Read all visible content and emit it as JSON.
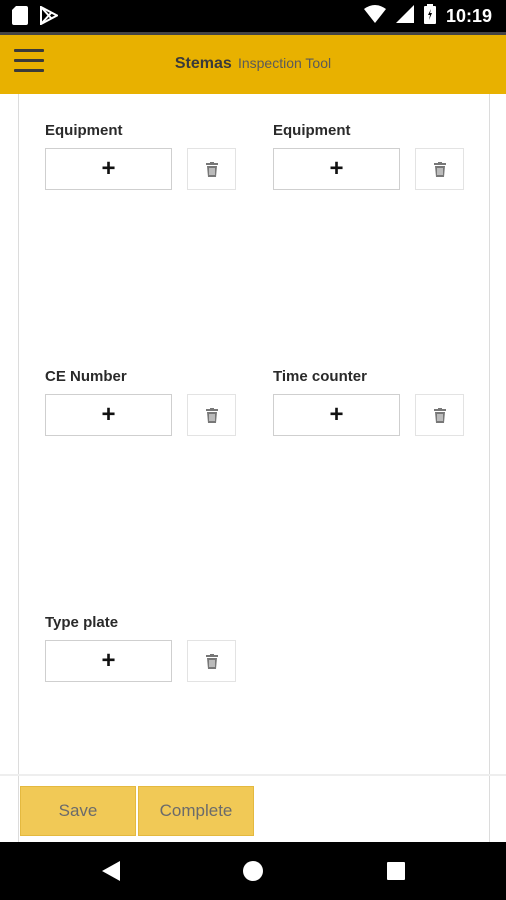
{
  "status_bar": {
    "time": "10:19",
    "icons": [
      "sd-card-icon",
      "play-store-icon",
      "wifi-icon",
      "signal-icon",
      "battery-icon"
    ]
  },
  "app_bar": {
    "brand": "Stemas",
    "subtitle": "Inspection Tool",
    "color": "#e8b100"
  },
  "fields": [
    {
      "label": "Equipment",
      "add_glyph": "+"
    },
    {
      "label": "Equipment",
      "add_glyph": "+"
    },
    {
      "label": "CE Number",
      "add_glyph": "+"
    },
    {
      "label": "Time counter",
      "add_glyph": "+"
    },
    {
      "label": "Type plate",
      "add_glyph": "+"
    }
  ],
  "footer": {
    "save_label": "Save",
    "complete_label": "Complete",
    "button_color": "#f1c956"
  },
  "nav": [
    "back-icon",
    "home-icon",
    "recents-icon"
  ]
}
